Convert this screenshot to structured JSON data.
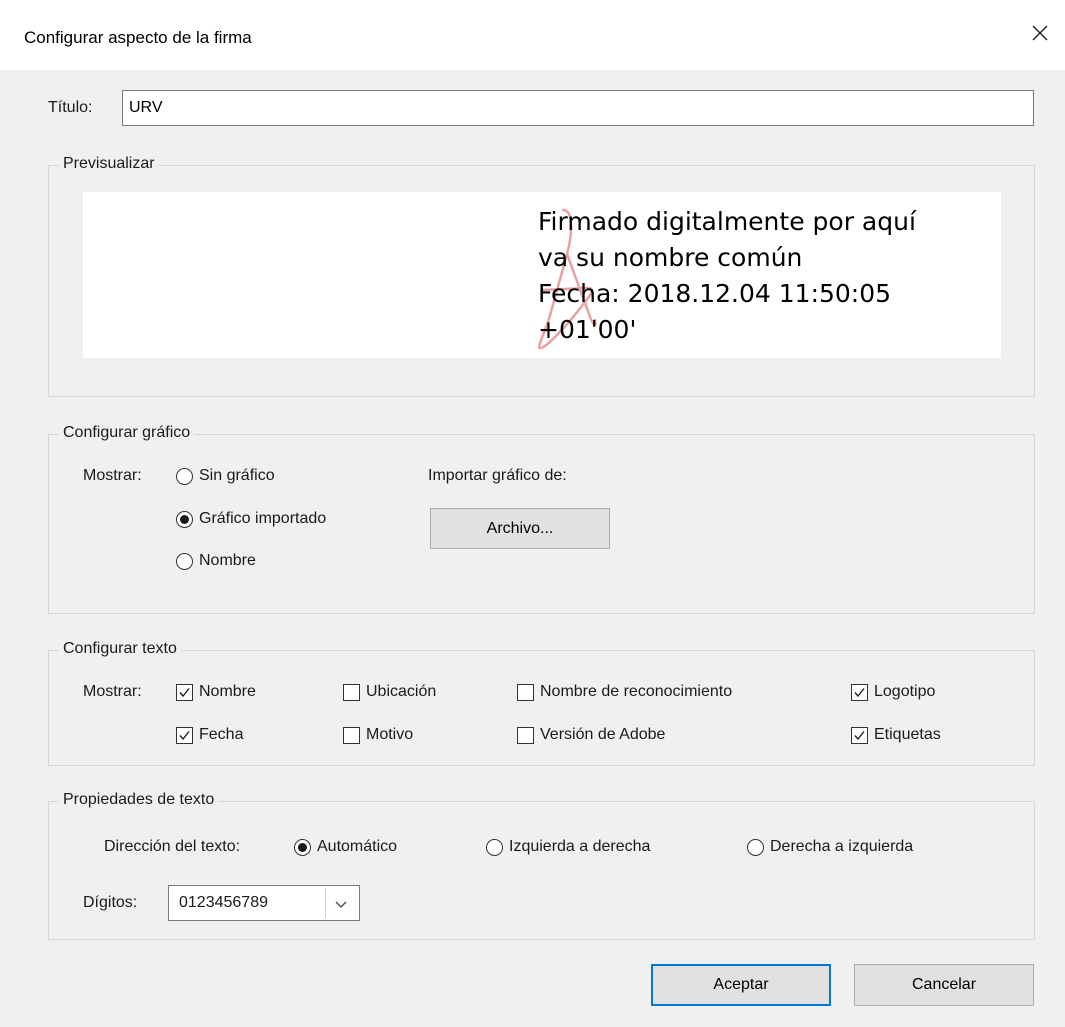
{
  "window": {
    "title": "Configurar aspecto de la firma",
    "close_icon": "close-icon"
  },
  "title_field": {
    "label": "Título:",
    "value": "URV"
  },
  "preview": {
    "legend": "Previsualizar",
    "lines": [
      "Firmado digitalmente por aquí",
      "va su nombre común",
      "Fecha: 2018.12.04 11:50:05",
      "+01'00'"
    ],
    "watermark_icon": "acrobat-logo-icon",
    "watermark_color": "#e8a0a0"
  },
  "graphic": {
    "legend": "Configurar gráfico",
    "show_label": "Mostrar:",
    "options": [
      {
        "label": "Sin gráfico",
        "checked": false
      },
      {
        "label": "Gráfico importado",
        "checked": true
      },
      {
        "label": "Nombre",
        "checked": false
      }
    ],
    "import_label": "Importar gráfico de:",
    "file_button": "Archivo..."
  },
  "text_config": {
    "legend": "Configurar texto",
    "show_label": "Mostrar:",
    "checkboxes": [
      {
        "label": "Nombre",
        "checked": true
      },
      {
        "label": "Ubicación",
        "checked": false
      },
      {
        "label": "Nombre de reconocimiento",
        "checked": false
      },
      {
        "label": "Logotipo",
        "checked": true
      },
      {
        "label": "Fecha",
        "checked": true
      },
      {
        "label": "Motivo",
        "checked": false
      },
      {
        "label": "Versión de Adobe",
        "checked": false
      },
      {
        "label": "Etiquetas",
        "checked": true
      }
    ]
  },
  "text_props": {
    "legend": "Propiedades de texto",
    "direction_label": "Dirección del texto:",
    "directions": [
      {
        "label": "Automático",
        "checked": true
      },
      {
        "label": "Izquierda a derecha",
        "checked": false
      },
      {
        "label": "Derecha a izquierda",
        "checked": false
      }
    ],
    "digits_label": "Dígitos:",
    "digits_value": "0123456789",
    "dropdown_icon": "chevron-down-icon"
  },
  "footer": {
    "accept": "Aceptar",
    "cancel": "Cancelar"
  },
  "colors": {
    "accent": "#0078d7",
    "dialog_bg": "#f0f0f0",
    "group_border": "#d7d7d7"
  }
}
